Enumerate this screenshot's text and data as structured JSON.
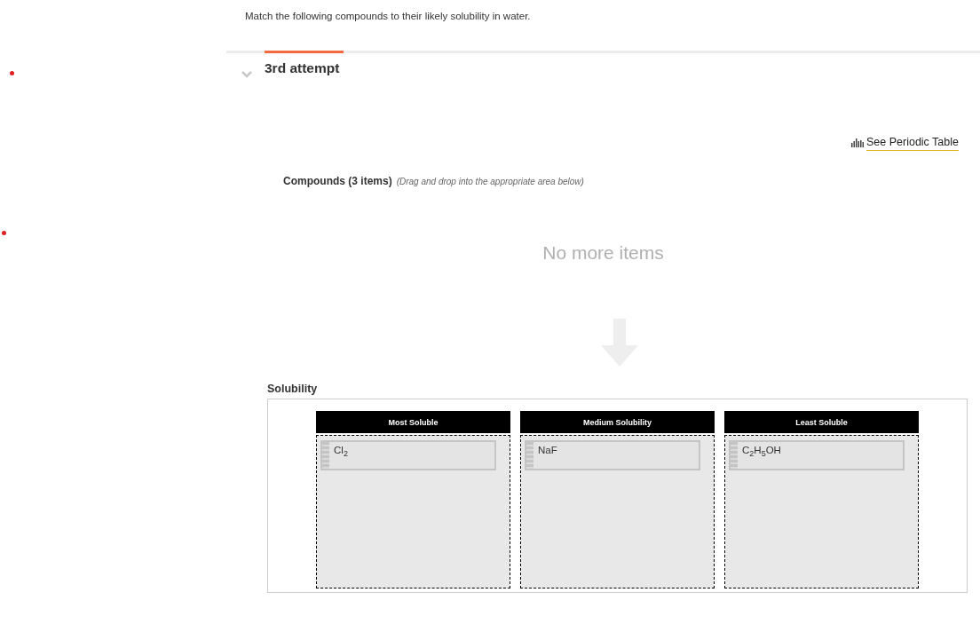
{
  "prompt": "Match the following compounds to their likely solubility in water.",
  "tabs": [
    {
      "label": "3rd attempt",
      "selected": true
    }
  ],
  "periodic_table_link": "See Periodic Table",
  "compounds": {
    "heading": "Compounds (3 items)",
    "hint": "(Drag and drop into the appropriate area below)",
    "empty_message": "No more items"
  },
  "solubility": {
    "title": "Solubility",
    "categories": [
      {
        "name": "Most Soluble",
        "items": [
          "Cl$_{2}$"
        ]
      },
      {
        "name": "Medium Solubility",
        "items": [
          "NaF"
        ]
      },
      {
        "name": "Least Soluble",
        "items": [
          "C$_{2}$H$_{5}$OH"
        ]
      }
    ]
  }
}
